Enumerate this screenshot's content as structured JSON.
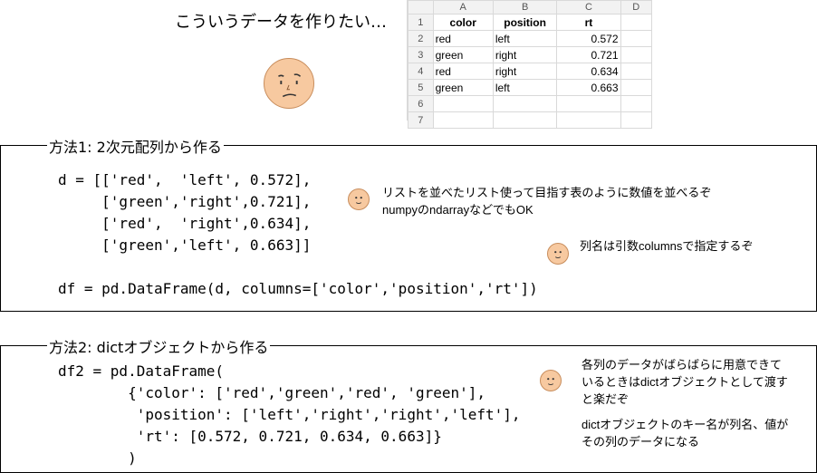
{
  "header": {
    "title": "こういうデータを作りたい…"
  },
  "spreadsheet": {
    "columns": [
      "",
      "A",
      "B",
      "C",
      "D"
    ],
    "rows": [
      {
        "num": "1",
        "cells": [
          "color",
          "position",
          "rt",
          ""
        ]
      },
      {
        "num": "2",
        "cells": [
          "red",
          "left",
          "0.572",
          ""
        ]
      },
      {
        "num": "3",
        "cells": [
          "green",
          "right",
          "0.721",
          ""
        ]
      },
      {
        "num": "4",
        "cells": [
          "red",
          "right",
          "0.634",
          ""
        ]
      },
      {
        "num": "5",
        "cells": [
          "green",
          "left",
          "0.663",
          ""
        ]
      },
      {
        "num": "6",
        "cells": [
          "",
          "",
          "",
          ""
        ]
      },
      {
        "num": "7",
        "cells": [
          "",
          "",
          "",
          ""
        ]
      }
    ]
  },
  "method1": {
    "title": "方法1: 2次元配列から作る",
    "code": "d = [['red',  'left', 0.572],\n     ['green','right',0.721],\n     ['red',  'right',0.634],\n     ['green','left', 0.663]]\n\ndf = pd.DataFrame(d, columns=['color','position','rt'])",
    "note1_line1": "リストを並べたリスト使って目指す表のように数値を並べるぞ",
    "note1_line2": "numpyのndarrayなどでもOK",
    "note2": "列名は引数columnsで指定するぞ"
  },
  "method2": {
    "title": "方法2: dictオブジェクトから作る",
    "code": "df2 = pd.DataFrame(\n        {'color': ['red','green','red', 'green'],\n         'position': ['left','right','right','left'],\n         'rt': [0.572, 0.721, 0.634, 0.663]}\n        )",
    "note1_line1": "各列のデータがばらばらに用意できて",
    "note1_line2": "いるときはdictオブジェクトとして渡す",
    "note1_line3": "と楽だぞ",
    "note2_line1": "dictオブジェクトのキー名が列名、値が",
    "note2_line2": "その列のデータになる"
  },
  "icons": {
    "face": "face-icon",
    "accent": "#f7c9a0"
  }
}
